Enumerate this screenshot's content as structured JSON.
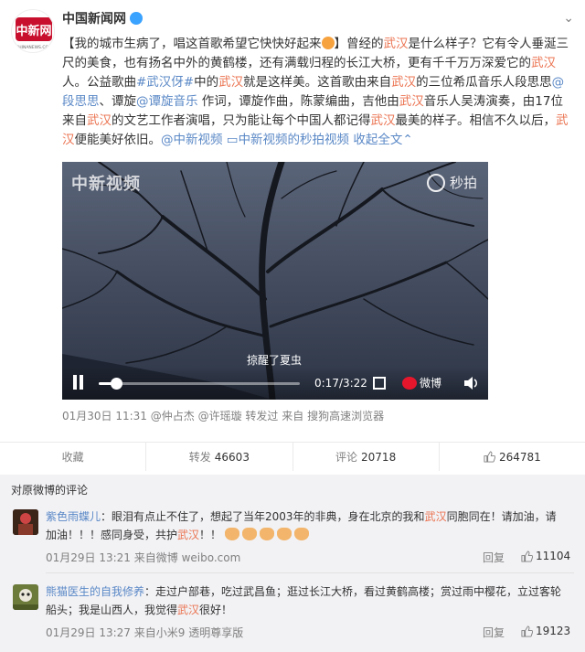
{
  "post": {
    "author": "中国新闻网",
    "collapse_icon": "chevron-down-icon",
    "logo_text": "中新网",
    "logo_sub": "CHINANEWS.COM",
    "text": {
      "p1": "【我的城市生病了，唱这首歌希望它快快好起来",
      "p2": "】曾经的",
      "wuhan": "武汉",
      "p3": "是什么样子？它有令人垂涎三尺的美食，也有扬名中外的黄鹤楼，还有满载归程的长江大桥，更有千千万万深爱它的",
      "p4": "人。公益歌曲",
      "tag": "#武汉伢#",
      "p5": "中的",
      "p6": "就是这样美。这首歌由来自",
      "p7": "的三位希瓜音乐人段思思",
      "mention1": "@段思思",
      "p8": "、谭旋",
      "mention2": "@谭旋音乐",
      "p9": " 作词，谭旋作曲，陈蒙编曲，吉他由",
      "p10": "音乐人吴涛演奏，由17位来自",
      "p11": "的文艺工作者演唱，只为能让每个中国人都记得",
      "p12": "最美的样子。相信不久以后，",
      "p13": "便能美好依旧。",
      "link1": "@中新视频",
      "link2": "中新视频的秒拍视频",
      "expand": "收起全文",
      "expand_icon": "chevron-up-icon"
    },
    "video": {
      "watermark_left": "中新视频",
      "watermark_right": "秒拍",
      "subtitle": "掠醒了夏虫",
      "time": "0:17/3:22",
      "progress": 0.088,
      "weibo_label": "微博"
    },
    "meta": {
      "date": "01月30日 11:31",
      "by": "@仲占杰",
      "forwarded": "@许瑶璇 转发过",
      "source": "来自 搜狗高速浏览器"
    },
    "actions": {
      "collect": "收藏",
      "repost_label": "转发",
      "repost_count": "46603",
      "comment_label": "评论",
      "comment_count": "20718",
      "like_count": "264781"
    }
  },
  "comments": {
    "title": "对原微博的评论",
    "items": [
      {
        "name": "紫色雨蝶儿",
        "text_a": "：眼泪有点止不住了，想起了当年2003年的非典，身在北京的我和",
        "hl1": "武汉",
        "text_b": "同胞同在！请加油，请加油！！！感同身受，共护",
        "hl2": "武汉",
        "text_c": "！！",
        "meta": "01月29日 13:21 来自微博 weibo.com",
        "reply": "回复",
        "likes": "11104"
      },
      {
        "name": "熊猫医生的自我修养",
        "text_a": "：走过户部巷，吃过武昌鱼；逛过长江大桥，看过黄鹤高楼；赏过雨中樱花，立过客轮船头；我是山西人，我觉得",
        "hl1": "武汉",
        "text_b": "很好！",
        "meta": "01月29日 13:27 来自小米9 透明尊享版",
        "reply": "回复",
        "likes": "19123"
      }
    ]
  }
}
